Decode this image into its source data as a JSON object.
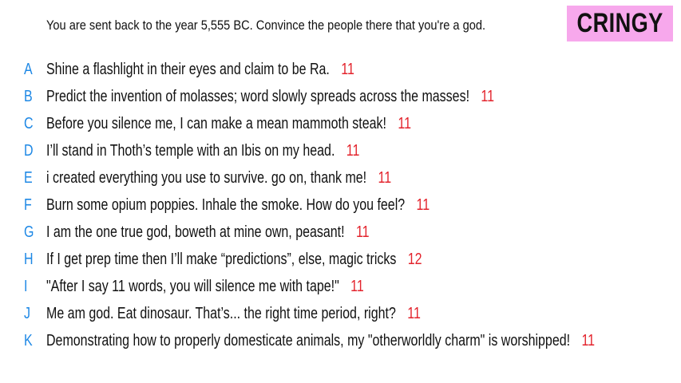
{
  "prompt": "You are sent back to the year 5,555 BC. Convince the people there that you're a god.",
  "badge": "CRINGY",
  "colors": {
    "letter": "#1e88e5",
    "score": "#e3232c",
    "badge_bg": "#f7a8ec"
  },
  "answers": [
    {
      "letter": "A",
      "text": "Shine a flashlight in their eyes and claim to be Ra.",
      "score": "11"
    },
    {
      "letter": "B",
      "text": "Predict the invention of molasses; word slowly spreads across the masses!",
      "score": "11"
    },
    {
      "letter": "C",
      "text": "Before you silence me, I can make a mean mammoth steak!",
      "score": "11"
    },
    {
      "letter": "D",
      "text": "I’ll stand in Thoth’s temple with an Ibis on my head.",
      "score": "11"
    },
    {
      "letter": "E",
      "text": "i created everything you use to survive. go on, thank me!",
      "score": "11"
    },
    {
      "letter": "F",
      "text": "Burn some opium poppies. Inhale the smoke. How do you feel?",
      "score": "11"
    },
    {
      "letter": "G",
      "text": "I am the one true god, boweth at mine own, peasant!",
      "score": "11"
    },
    {
      "letter": "H",
      "text": "If I get prep time then I’ll make “predictions”, else, magic tricks",
      "score": "12"
    },
    {
      "letter": "I",
      "text": "\"After I say 11 words, you will silence me with tape!\"",
      "score": "11"
    },
    {
      "letter": "J",
      "text": "Me am god. Eat dinosaur. That’s... the right time period, right?",
      "score": "11"
    },
    {
      "letter": "K",
      "text": "Demonstrating how to properly domesticate animals, my \"otherworldly charm\" is worshipped!",
      "score": "11"
    }
  ]
}
